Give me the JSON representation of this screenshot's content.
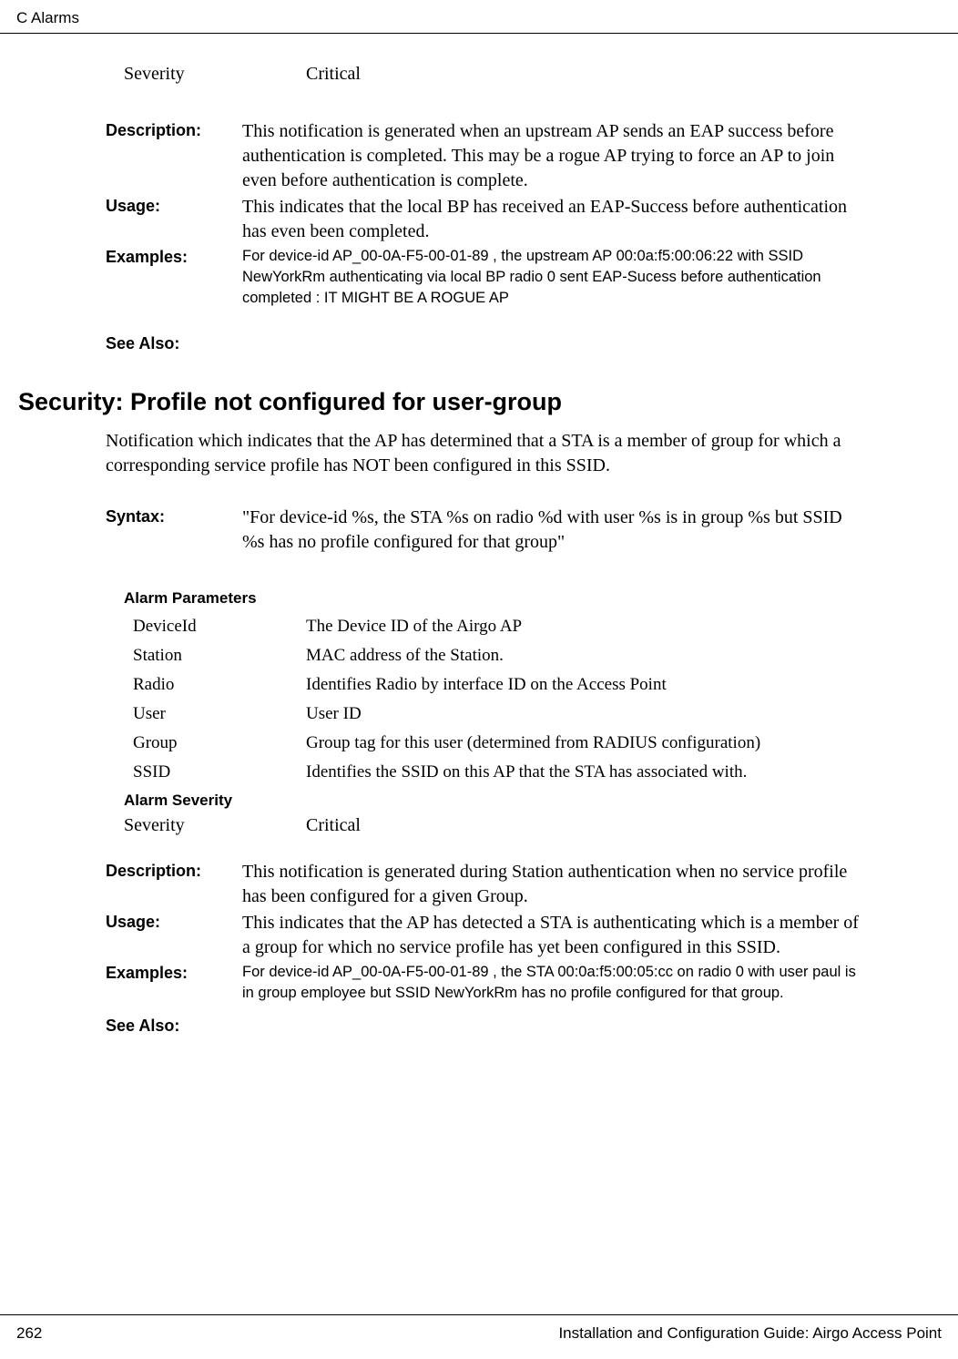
{
  "header": {
    "chapter": "C  Alarms"
  },
  "top_block": {
    "severity_label": "Severity",
    "severity_value": "Critical",
    "description_label": "Description:",
    "description_text": "This notification is generated when an upstream AP sends an EAP success before authentication is completed. This may be a rogue AP trying to force an AP to join even before authentication is complete.",
    "usage_label": "Usage:",
    "usage_text": "This indicates that the local BP has received an EAP-Success before authentication has even been completed.",
    "examples_label": "Examples:",
    "examples_text": "For device-id AP_00-0A-F5-00-01-89 , the upstream AP 00:0a:f5:00:06:22 with SSID NewYorkRm authenticating via local BP radio 0 sent EAP-Sucess before authentication completed : IT MIGHT BE A ROGUE AP",
    "see_also_label": "See Also:"
  },
  "section": {
    "title": "Security: Profile not configured for user-group",
    "intro": "Notification which indicates that the AP has determined that a STA is a member of group for which a corresponding service profile has NOT been configured in this SSID.",
    "syntax_label": "Syntax:",
    "syntax_text": "\"For device-id %s, the STA %s on radio %d with user %s is in group %s but SSID %s has no profile configured for that group\"",
    "params_header": "Alarm Parameters",
    "params": [
      {
        "name": "DeviceId",
        "desc": "The Device ID of the Airgo AP"
      },
      {
        "name": "Station",
        "desc": "MAC address of the Station."
      },
      {
        "name": "Radio",
        "desc": "Identifies Radio by interface ID on the Access Point"
      },
      {
        "name": "User",
        "desc": "User ID"
      },
      {
        "name": "Group",
        "desc": "Group tag for this user (determined from RADIUS configuration)"
      },
      {
        "name": "SSID",
        "desc": "Identifies the SSID on this AP that the STA has associated with."
      }
    ],
    "severity_header": "Alarm Severity",
    "severity_label": "Severity",
    "severity_value": "Critical",
    "description_label": "Description:",
    "description_text": "This notification is generated during Station authentication when no service profile has been configured for a given Group.",
    "usage_label": "Usage:",
    "usage_text": "This indicates that the AP has detected a STA is authenticating which is a member of a group for which no service profile has yet been configured  in this SSID.",
    "examples_label": "Examples:",
    "examples_text": "For device-id AP_00-0A-F5-00-01-89 , the STA 00:0a:f5:00:05:cc  on radio 0 with user paul is in group employee but SSID NewYorkRm has no profile configured for that group.",
    "see_also_label": "See Also:"
  },
  "footer": {
    "page_num": "262",
    "book": "Installation and Configuration Guide: Airgo Access Point"
  }
}
